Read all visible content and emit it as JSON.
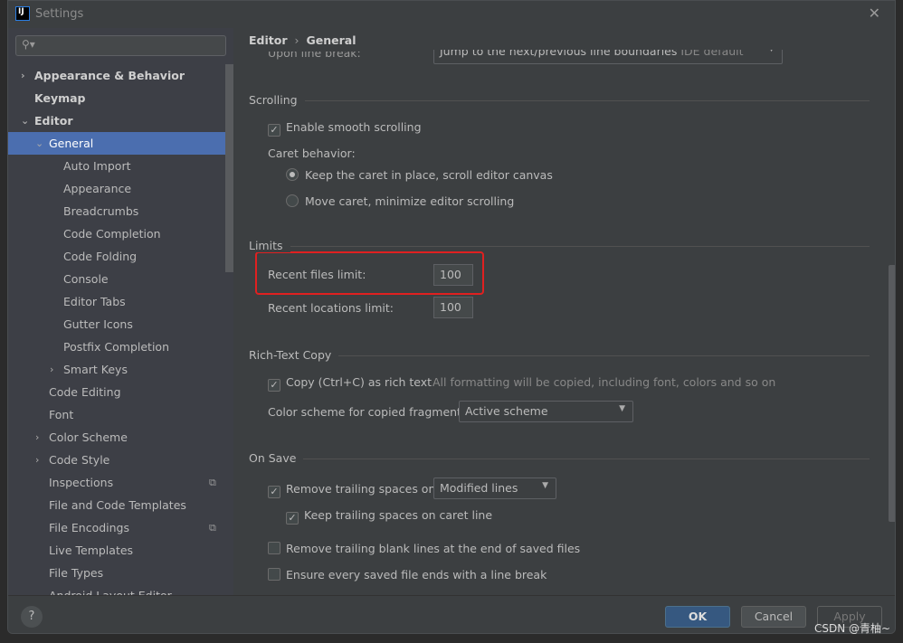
{
  "window": {
    "title": "Settings",
    "logo": "IJ"
  },
  "search": {
    "placeholder": ""
  },
  "tree": [
    {
      "label": "Appearance & Behavior",
      "level": 0,
      "arrow": "›",
      "bold": true
    },
    {
      "label": "Keymap",
      "level": 0,
      "bold": true
    },
    {
      "label": "Editor",
      "level": 0,
      "arrow": "⌄",
      "bold": true
    },
    {
      "label": "General",
      "level": 1,
      "arrow": "⌄",
      "selected": true
    },
    {
      "label": "Auto Import",
      "level": 2
    },
    {
      "label": "Appearance",
      "level": 2
    },
    {
      "label": "Breadcrumbs",
      "level": 2
    },
    {
      "label": "Code Completion",
      "level": 2
    },
    {
      "label": "Code Folding",
      "level": 2
    },
    {
      "label": "Console",
      "level": 2
    },
    {
      "label": "Editor Tabs",
      "level": 2
    },
    {
      "label": "Gutter Icons",
      "level": 2
    },
    {
      "label": "Postfix Completion",
      "level": 2
    },
    {
      "label": "Smart Keys",
      "level": 2,
      "arrow": "›"
    },
    {
      "label": "Code Editing",
      "level": 1
    },
    {
      "label": "Font",
      "level": 1
    },
    {
      "label": "Color Scheme",
      "level": 1,
      "arrow": "›"
    },
    {
      "label": "Code Style",
      "level": 1,
      "arrow": "›"
    },
    {
      "label": "Inspections",
      "level": 1,
      "badge": "copy-icon"
    },
    {
      "label": "File and Code Templates",
      "level": 1
    },
    {
      "label": "File Encodings",
      "level": 1,
      "badge": "copy-icon"
    },
    {
      "label": "Live Templates",
      "level": 1
    },
    {
      "label": "File Types",
      "level": 1
    },
    {
      "label": "Android Layout Editor",
      "level": 1
    }
  ],
  "breadcrumb": {
    "parent": "Editor",
    "current": "General"
  },
  "main": {
    "upon_line_break": {
      "label": "Upon line break:",
      "value": "Jump to the next/previous line boundaries",
      "hint": "IDE default"
    },
    "scrolling": {
      "title": "Scrolling",
      "smooth": {
        "label": "Enable smooth scrolling",
        "checked": true
      },
      "caret_label": "Caret behavior:",
      "caret_options": [
        {
          "label": "Keep the caret in place, scroll editor canvas",
          "selected": true
        },
        {
          "label": "Move caret, minimize editor scrolling",
          "selected": false
        }
      ]
    },
    "limits": {
      "title": "Limits",
      "recent_files_label": "Recent files limit:",
      "recent_files": "100",
      "recent_locations_label": "Recent locations limit:",
      "recent_locations": "100"
    },
    "rich": {
      "title": "Rich-Text Copy",
      "copy": {
        "label": "Copy (Ctrl+C) as rich text",
        "checked": true
      },
      "hint": "All formatting will be copied, including font, colors and so on",
      "scheme_label": "Color scheme for copied fragment:",
      "scheme": "Active scheme"
    },
    "onsave": {
      "title": "On Save",
      "remove_trailing": {
        "label": "Remove trailing spaces on:",
        "checked": true
      },
      "remove_mode": "Modified lines",
      "keep": {
        "label": "Keep trailing spaces on caret line",
        "checked": true
      },
      "blank": {
        "label": "Remove trailing blank lines at the end of saved files",
        "checked": false
      },
      "ensure": {
        "label": "Ensure every saved file ends with a line break",
        "checked": false
      }
    }
  },
  "buttons": {
    "help": "?",
    "ok": "OK",
    "cancel": "Cancel",
    "apply": "Apply"
  },
  "watermark": "CSDN @青柚~",
  "colors": {
    "selection": "#4b6eaf",
    "highlight": "#e02020",
    "ok": "#365880"
  }
}
